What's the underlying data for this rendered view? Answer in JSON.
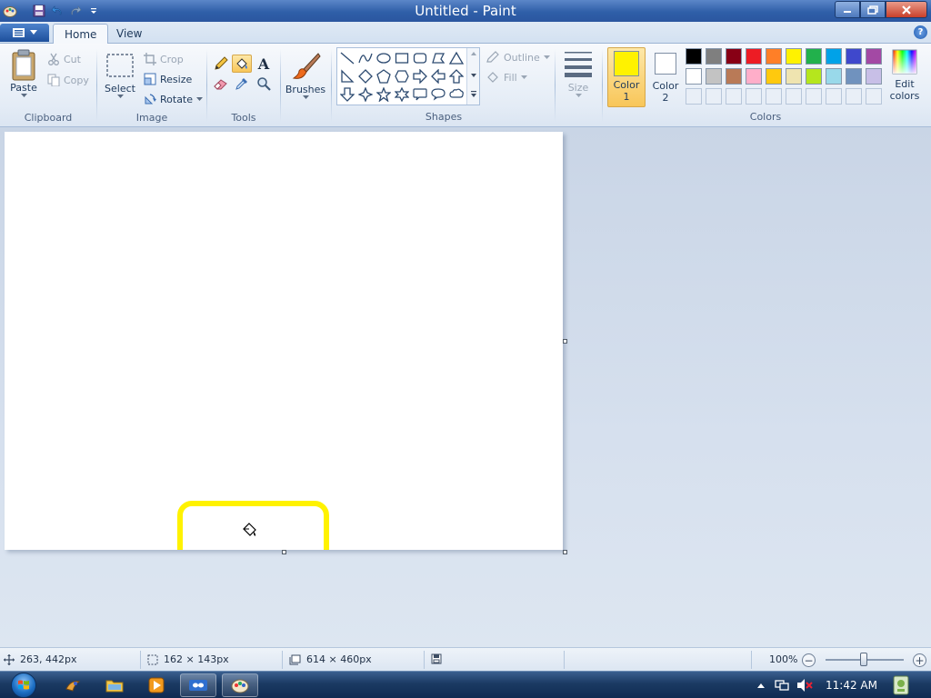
{
  "window": {
    "title": "Untitled - Paint"
  },
  "tabs": {
    "home": "Home",
    "view": "View"
  },
  "ribbon": {
    "clipboard": {
      "label": "Clipboard",
      "paste": "Paste",
      "cut": "Cut",
      "copy": "Copy"
    },
    "image": {
      "label": "Image",
      "select": "Select",
      "crop": "Crop",
      "resize": "Resize",
      "rotate": "Rotate"
    },
    "tools": {
      "label": "Tools",
      "selected_tool": "fill-bucket-icon"
    },
    "brushes": {
      "label": "Brushes"
    },
    "shapes": {
      "label": "Shapes",
      "outline": "Outline",
      "fill": "Fill"
    },
    "size": {
      "label": "Size"
    },
    "colors": {
      "label": "Colors",
      "color1_line1": "Color",
      "color1_line2": "1",
      "color2_line1": "Color",
      "color2_line2": "2",
      "edit_line1": "Edit",
      "edit_line2": "colors",
      "color1_value": "#FFF200",
      "color2_value": "#FFFFFF",
      "palette_row1": [
        "#000000",
        "#7F7F7F",
        "#880015",
        "#ED1C24",
        "#FF7F27",
        "#FFF200",
        "#22B14C",
        "#00A2E8",
        "#3F48CC",
        "#A349A4"
      ],
      "palette_row2": [
        "#FFFFFF",
        "#C3C3C3",
        "#B97A57",
        "#FFAEC9",
        "#FFC90E",
        "#EFE4B0",
        "#B5E61D",
        "#99D9EA",
        "#7092BE",
        "#C8BFE7"
      ]
    }
  },
  "statusbar": {
    "cursor_pos": "263, 442px",
    "selection_size": "162 × 143px",
    "canvas_size": "614 × 460px",
    "zoom": "100%"
  },
  "taskbar": {
    "clock": "11:42 AM"
  }
}
